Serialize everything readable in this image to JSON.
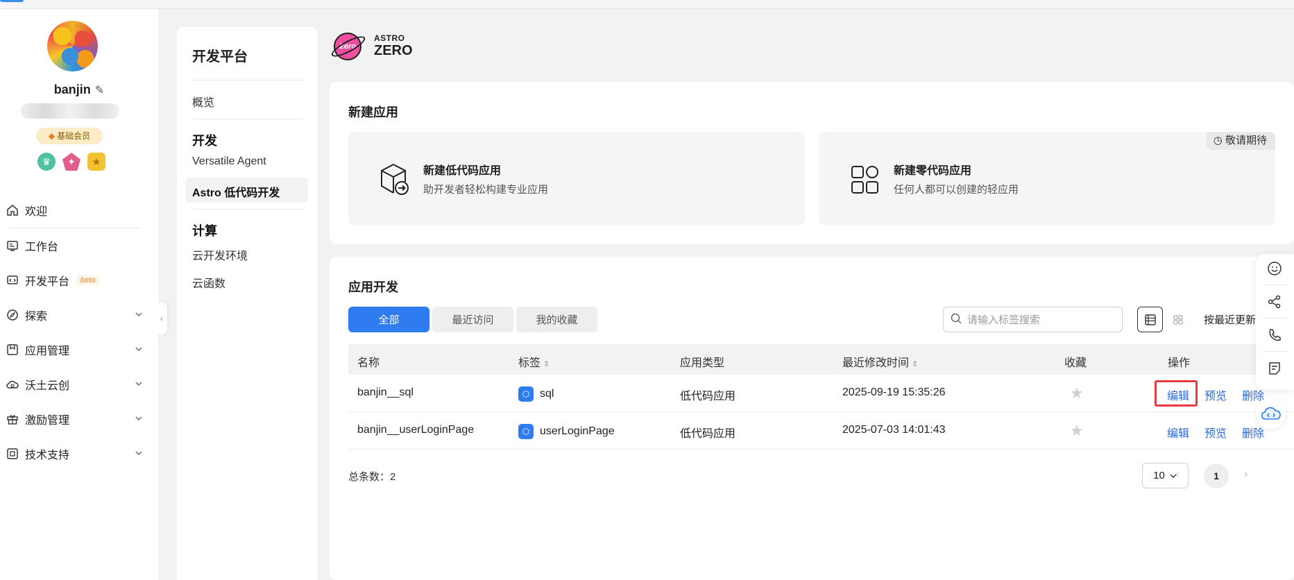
{
  "user": {
    "name": "banjin",
    "membership": "基础会员"
  },
  "nav": {
    "items": [
      {
        "label": "欢迎",
        "icon": "home-icon"
      },
      {
        "label": "工作台",
        "icon": "workbench-icon"
      },
      {
        "label": "开发平台",
        "icon": "dev-platform-icon",
        "badge": "beta"
      },
      {
        "label": "探索",
        "icon": "explore-icon"
      },
      {
        "label": "应用管理",
        "icon": "app-manage-icon"
      },
      {
        "label": "沃土云创",
        "icon": "cloud-create-icon"
      },
      {
        "label": "激励管理",
        "icon": "gift-icon"
      },
      {
        "label": "技术支持",
        "icon": "support-icon"
      }
    ]
  },
  "subnav": {
    "title": "开发平台",
    "overview": "概览",
    "dev_heading": "开发",
    "versatile": "Versatile Agent",
    "astro": "Astro 低代码开发",
    "compute_heading": "计算",
    "cloud_env": "云开发环境",
    "cloud_func": "云函数"
  },
  "logo": {
    "badge": "Zero",
    "brand_top": "ASTRO",
    "brand_bottom": "ZERO"
  },
  "new_app": {
    "title": "新建应用",
    "lowcode_title": "新建低代码应用",
    "lowcode_desc": "助开发者轻松构建专业应用",
    "nocode_title": "新建零代码应用",
    "nocode_desc": "任何人都可以创建的轻应用",
    "coming_soon": "敬请期待"
  },
  "app_dev": {
    "title": "应用开发",
    "tabs": [
      "全部",
      "最近访问",
      "我的收藏"
    ],
    "active_tab": 0,
    "search_placeholder": "请输入标签搜索",
    "sort_label": "按最近更新",
    "columns": [
      "名称",
      "标签",
      "应用类型",
      "最近修改时间",
      "收藏",
      "操作"
    ],
    "rows": [
      {
        "name": "banjin__sql",
        "tag": "sql",
        "type": "低代码应用",
        "modified": "2025-09-19 15:35:26"
      },
      {
        "name": "banjin__userLoginPage",
        "tag": "userLoginPage",
        "type": "低代码应用",
        "modified": "2025-07-03 14:01:43"
      }
    ],
    "actions": {
      "edit": "编辑",
      "preview": "预览",
      "delete": "删除"
    },
    "total_label": "总条数：2",
    "page_size": "10",
    "current_page": "1"
  },
  "colors": {
    "accent": "#2f7bf0",
    "highlight": "#e83b3b",
    "beta": "#f08a24"
  }
}
